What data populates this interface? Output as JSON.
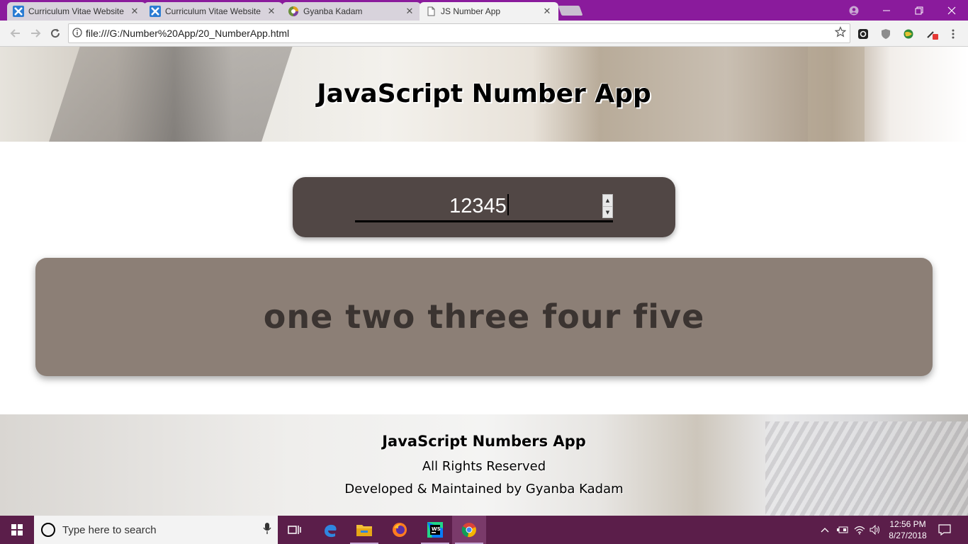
{
  "browser": {
    "tabs": [
      {
        "title": "Curriculum Vitae Website",
        "icon": "x-logo-icon",
        "active": false
      },
      {
        "title": "Curriculum Vitae Website",
        "icon": "x-logo-icon",
        "active": false
      },
      {
        "title": "Gyanba Kadam",
        "icon": "colorful-circle-icon",
        "active": false
      },
      {
        "title": "JS Number App",
        "icon": "page-icon",
        "active": true
      }
    ],
    "tab_close": "✕",
    "url": "file:///G:/Number%20App/20_NumberApp.html"
  },
  "page": {
    "header_title": "JavaScript Number App",
    "number_input": {
      "value": "12345"
    },
    "output_words": "one two three four five",
    "footer": {
      "title": "JavaScript Numbers App",
      "rights": "All Rights Reserved",
      "credit": "Developed & Maintained by Gyanba Kadam"
    }
  },
  "taskbar": {
    "search_placeholder": "Type here to search",
    "time": "12:56 PM",
    "date": "8/27/2018"
  },
  "colors": {
    "tabbar": "#8a1b9c",
    "input_card": "#514745",
    "output_card": "#8c7f76",
    "output_text": "#3b3431",
    "taskbar": "#5b1e4a"
  }
}
